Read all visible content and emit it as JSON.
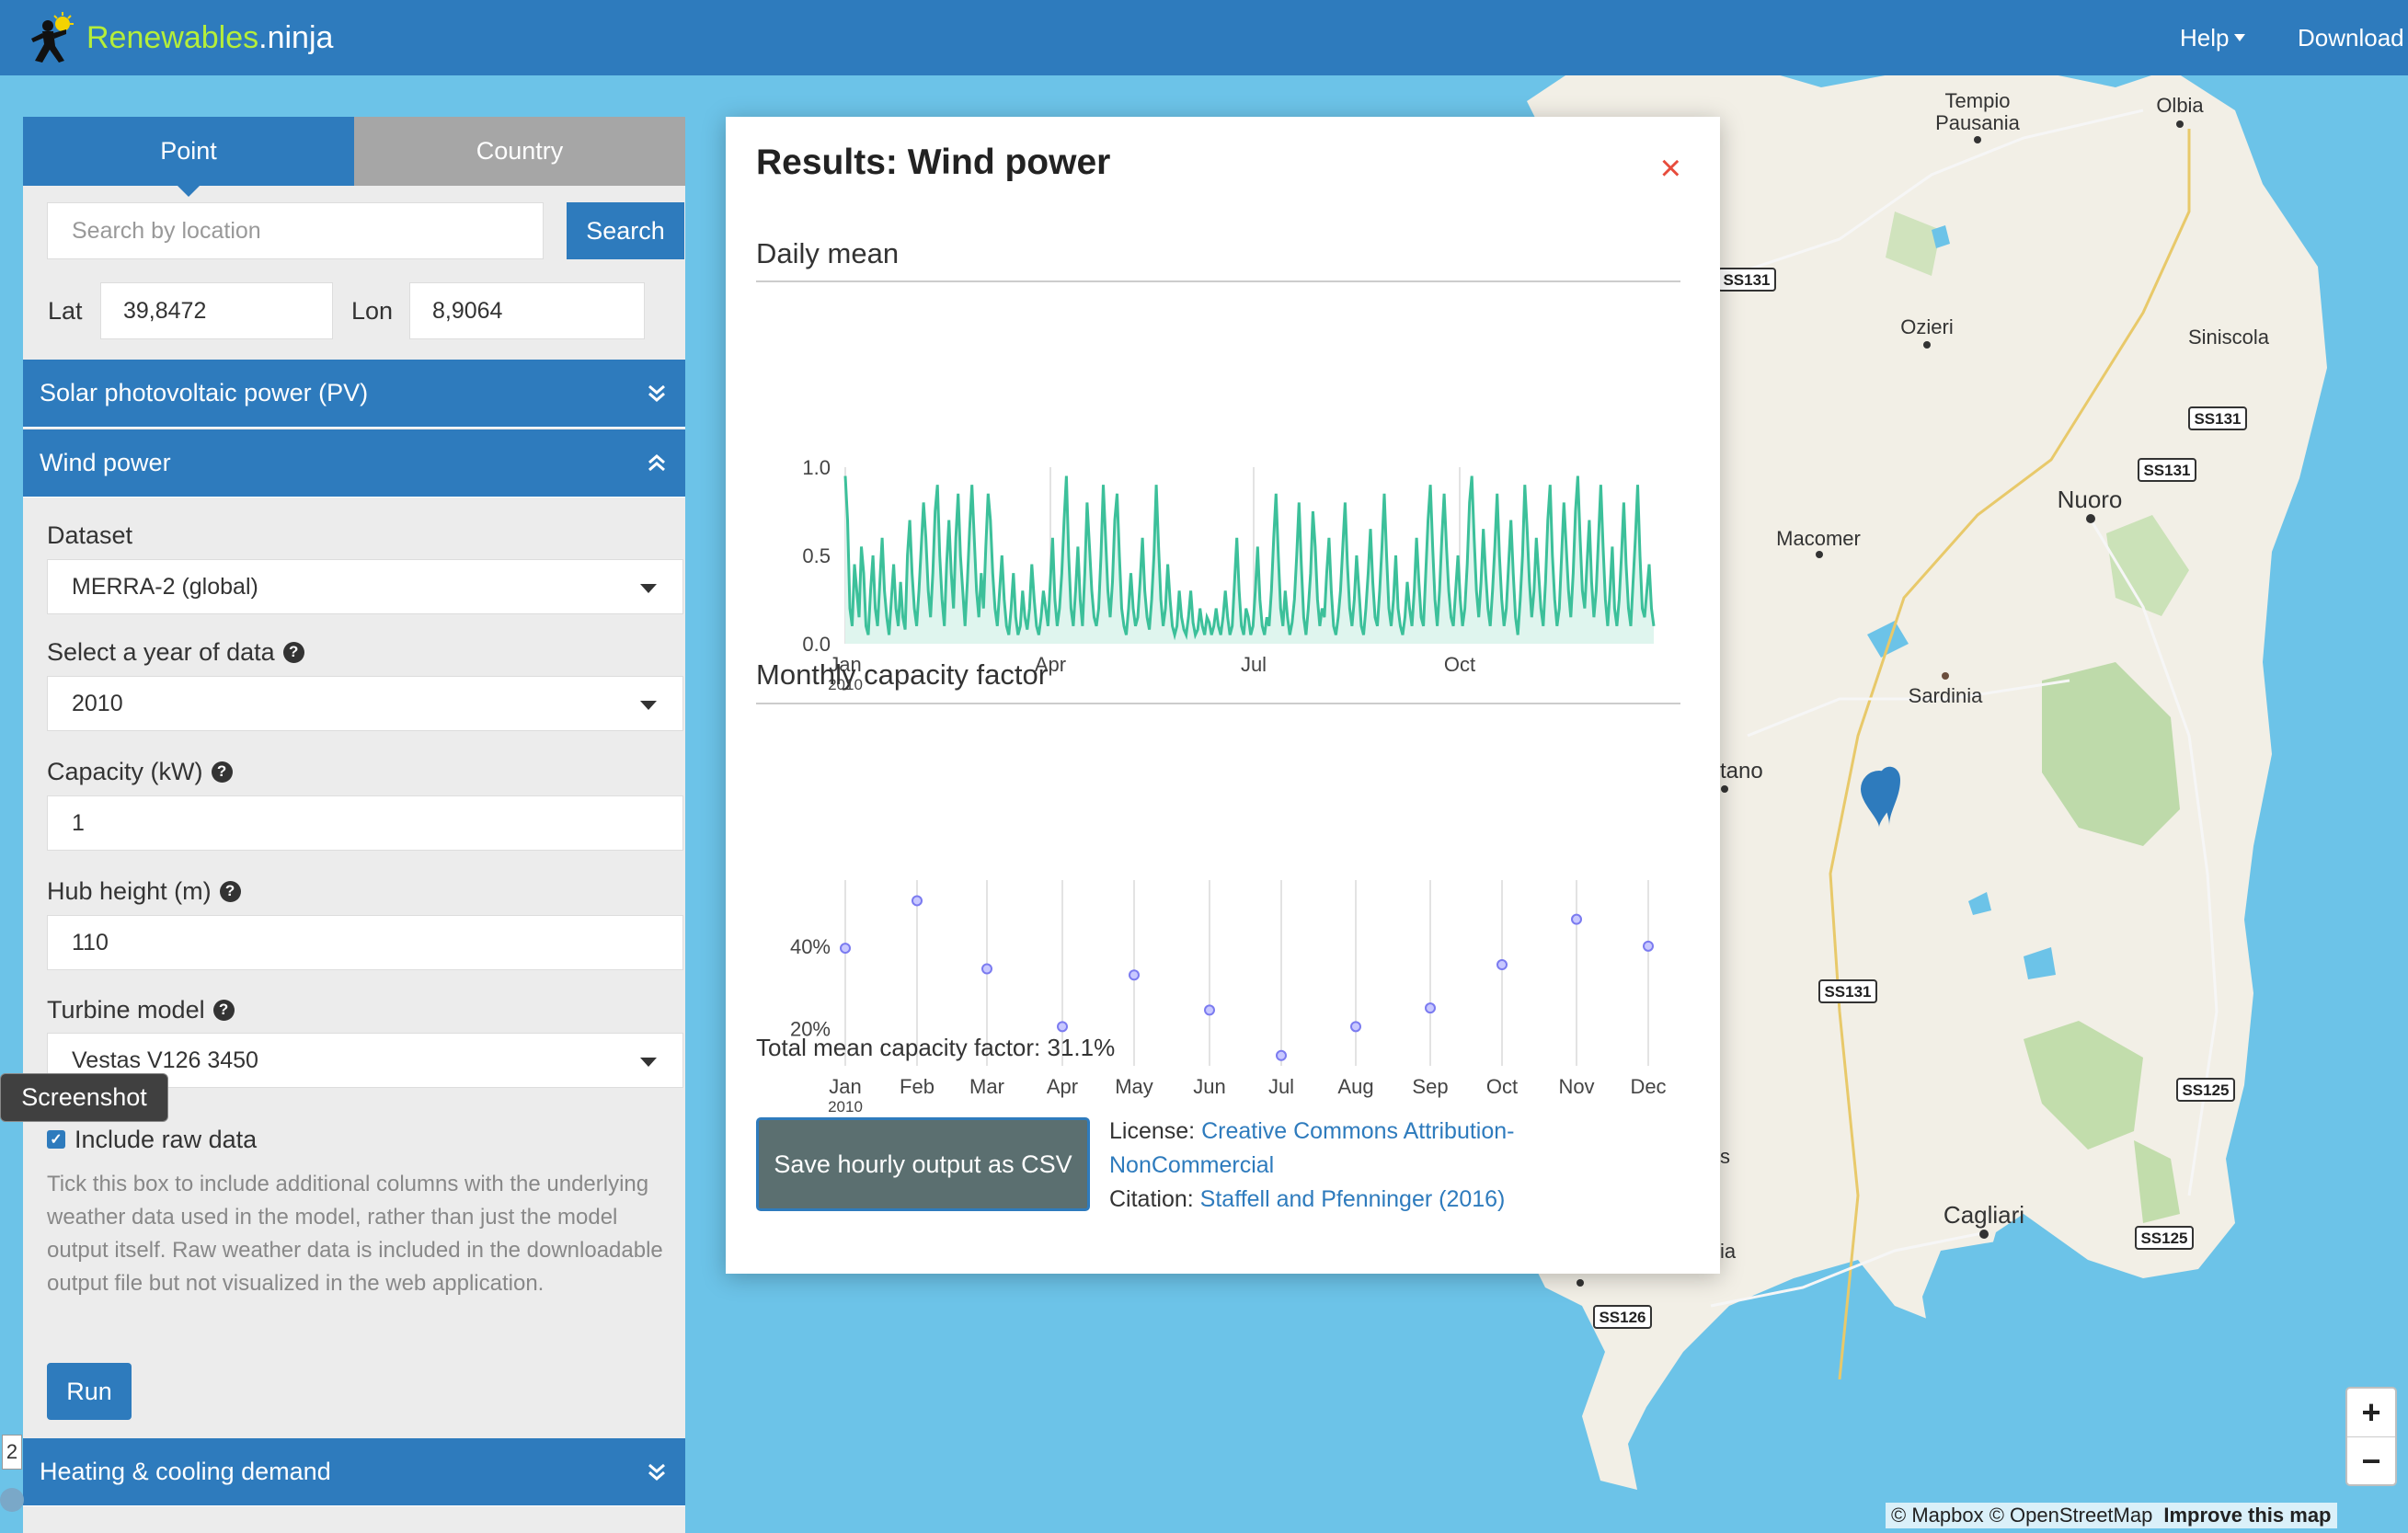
{
  "navbar": {
    "brand_part1": "Renewables",
    "brand_part2": ".ninja",
    "help": "Help",
    "download": "Download"
  },
  "sidebar": {
    "tabs": [
      {
        "label": "Point",
        "active": true
      },
      {
        "label": "Country",
        "active": false
      }
    ],
    "search": {
      "placeholder": "Search by location",
      "button": "Search"
    },
    "lat_label": "Lat",
    "lat_value": "39,8472",
    "lon_label": "Lon",
    "lon_value": "8,9064",
    "panels": {
      "solar": "Solar photovoltaic power (PV)",
      "wind": "Wind power",
      "heating": "Heating & cooling demand"
    },
    "form": {
      "dataset_label": "Dataset",
      "dataset_value": "MERRA-2 (global)",
      "year_label": "Select a year of data",
      "year_value": "2010",
      "capacity_label": "Capacity (kW)",
      "capacity_value": "1",
      "hub_label": "Hub height (m)",
      "hub_value": "110",
      "turbine_label": "Turbine model",
      "turbine_value": "Vestas V126 3450",
      "raw_label": "Include raw data",
      "raw_checked": true,
      "help_text": "Tick this box to include additional columns with the underlying weather data used in the model, rather than just the model output itself. Raw weather data is included in the downloadable output file but not visualized in the web application.",
      "run": "Run"
    },
    "tooltip": "Screenshot",
    "side_number": "2"
  },
  "modal": {
    "title": "Results: Wind power",
    "close": "×",
    "daily_title": "Daily mean",
    "monthly_title": "Monthly capacity factor",
    "total": "Total mean capacity factor: 31.1%",
    "csv_button": "Save hourly output as CSV",
    "license_label": "License:",
    "license_link": "Creative Commons Attribution-NonCommercial",
    "citation_label": "Citation:",
    "citation_link": "Staffell and Pfenninger (2016)"
  },
  "map": {
    "labels": [
      "Tempio Pausania",
      "Olbia",
      "Ozieri",
      "Siniscola",
      "Nuoro",
      "Macomer",
      "Sardinia",
      "tano",
      "Cagliari",
      "s",
      "ia"
    ],
    "roads": [
      "SS131",
      "SS131",
      "SS131",
      "SS131",
      "SS125",
      "SS125",
      "SS126"
    ],
    "zoom_in": "+",
    "zoom_out": "−",
    "attribution": "© Mapbox © OpenStreetMap",
    "improve": "Improve this map"
  },
  "chart_data": [
    {
      "type": "area",
      "title": "Daily mean",
      "x_start": "2010-01-01",
      "x_end": "2010-12-31",
      "xtick_labels": [
        "Jan",
        "Apr",
        "Jul",
        "Oct"
      ],
      "xtick_sub": "2010",
      "ylim": [
        0,
        1
      ],
      "ytick_labels": [
        "0.0",
        "0.5",
        "1.0"
      ],
      "color": "#3cc09a",
      "series": [
        {
          "values": [
            0.95,
            0.7,
            0.2,
            0.1,
            0.45,
            0.3,
            0.15,
            0.55,
            0.4,
            0.1,
            0.05,
            0.3,
            0.5,
            0.2,
            0.1,
            0.35,
            0.6,
            0.3,
            0.15,
            0.05,
            0.25,
            0.45,
            0.2,
            0.1,
            0.35,
            0.15,
            0.08,
            0.5,
            0.7,
            0.4,
            0.2,
            0.1,
            0.3,
            0.55,
            0.8,
            0.6,
            0.3,
            0.15,
            0.4,
            0.75,
            0.9,
            0.5,
            0.25,
            0.1,
            0.45,
            0.7,
            0.4,
            0.2,
            0.6,
            0.85,
            0.5,
            0.3,
            0.1,
            0.35,
            0.65,
            0.9,
            0.6,
            0.3,
            0.15,
            0.4,
            0.2,
            0.55,
            0.85,
            0.7,
            0.4,
            0.2,
            0.1,
            0.3,
            0.5,
            0.25,
            0.1,
            0.05,
            0.2,
            0.4,
            0.15,
            0.05,
            0.1,
            0.3,
            0.15,
            0.08,
            0.2,
            0.45,
            0.25,
            0.1,
            0.05,
            0.15,
            0.3,
            0.2,
            0.1,
            0.35,
            0.6,
            0.25,
            0.1,
            0.2,
            0.4,
            0.7,
            0.95,
            0.5,
            0.2,
            0.1,
            0.3,
            0.55,
            0.25,
            0.1,
            0.4,
            0.8,
            0.55,
            0.3,
            0.15,
            0.1,
            0.2,
            0.5,
            0.9,
            0.6,
            0.3,
            0.15,
            0.35,
            0.7,
            0.85,
            0.5,
            0.2,
            0.1,
            0.05,
            0.2,
            0.4,
            0.2,
            0.1,
            0.15,
            0.35,
            0.6,
            0.3,
            0.15,
            0.08,
            0.25,
            0.5,
            0.9,
            0.55,
            0.25,
            0.1,
            0.2,
            0.45,
            0.25,
            0.1,
            0.05,
            0.1,
            0.3,
            0.15,
            0.08,
            0.05,
            0.15,
            0.3,
            0.12,
            0.05,
            0.08,
            0.2,
            0.1,
            0.05,
            0.15,
            0.12,
            0.05,
            0.1,
            0.2,
            0.1,
            0.05,
            0.15,
            0.3,
            0.15,
            0.05,
            0.1,
            0.35,
            0.6,
            0.3,
            0.1,
            0.05,
            0.2,
            0.15,
            0.05,
            0.1,
            0.3,
            0.55,
            0.25,
            0.1,
            0.05,
            0.15,
            0.1,
            0.3,
            0.6,
            0.85,
            0.5,
            0.2,
            0.1,
            0.3,
            0.15,
            0.05,
            0.12,
            0.25,
            0.5,
            0.8,
            0.45,
            0.15,
            0.05,
            0.2,
            0.4,
            0.75,
            0.55,
            0.25,
            0.1,
            0.2,
            0.15,
            0.4,
            0.6,
            0.3,
            0.1,
            0.05,
            0.15,
            0.3,
            0.55,
            0.8,
            0.45,
            0.2,
            0.1,
            0.25,
            0.5,
            0.3,
            0.1,
            0.05,
            0.2,
            0.4,
            0.65,
            0.35,
            0.15,
            0.1,
            0.3,
            0.55,
            0.85,
            0.5,
            0.2,
            0.1,
            0.25,
            0.5,
            0.2,
            0.1,
            0.05,
            0.15,
            0.35,
            0.2,
            0.1,
            0.3,
            0.6,
            0.35,
            0.15,
            0.1,
            0.4,
            0.7,
            0.9,
            0.55,
            0.25,
            0.1,
            0.3,
            0.6,
            0.85,
            0.55,
            0.3,
            0.15,
            0.1,
            0.3,
            0.5,
            0.25,
            0.1,
            0.2,
            0.45,
            0.8,
            0.95,
            0.6,
            0.3,
            0.15,
            0.35,
            0.65,
            0.4,
            0.2,
            0.1,
            0.3,
            0.55,
            0.85,
            0.5,
            0.25,
            0.1,
            0.2,
            0.45,
            0.7,
            0.4,
            0.15,
            0.05,
            0.25,
            0.5,
            0.9,
            0.65,
            0.35,
            0.15,
            0.3,
            0.6,
            0.4,
            0.2,
            0.1,
            0.35,
            0.7,
            0.9,
            0.5,
            0.25,
            0.1,
            0.2,
            0.5,
            0.8,
            0.55,
            0.3,
            0.15,
            0.4,
            0.75,
            0.95,
            0.6,
            0.3,
            0.2,
            0.45,
            0.7,
            0.35,
            0.15,
            0.3,
            0.6,
            0.9,
            0.55,
            0.25,
            0.1,
            0.3,
            0.55,
            0.2,
            0.1,
            0.25,
            0.5,
            0.8,
            0.45,
            0.2,
            0.1,
            0.35,
            0.6,
            0.9,
            0.5,
            0.2,
            0.15,
            0.3,
            0.45,
            0.2,
            0.1
          ]
        }
      ]
    },
    {
      "type": "scatter",
      "title": "Monthly capacity factor",
      "categories": [
        "Jan",
        "Feb",
        "Mar",
        "Apr",
        "May",
        "Jun",
        "Jul",
        "Aug",
        "Sep",
        "Oct",
        "Nov",
        "Dec"
      ],
      "xtick_sub": "2010",
      "values": [
        39.5,
        51,
        34.5,
        20.5,
        33,
        24.5,
        13.5,
        20.5,
        25,
        35.5,
        46.5,
        40
      ],
      "ylim": [
        11,
        56
      ],
      "ytick_labels": [
        "20%",
        "40%"
      ],
      "ytick_values": [
        20,
        40
      ],
      "color": "#7b7bf0"
    }
  ]
}
